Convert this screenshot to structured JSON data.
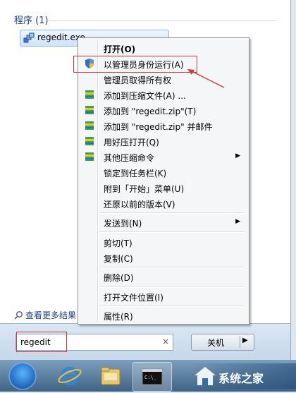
{
  "start_menu": {
    "section_header": "程序 (1)",
    "program": "regedit.exe",
    "see_more": "查看更多结果"
  },
  "context_menu": {
    "items": [
      {
        "label": "打开(O)",
        "icon": "none",
        "bold": true
      },
      {
        "label": "以管理员身份运行(A)",
        "icon": "uac-shield-icon"
      },
      {
        "label": "管理员取得所有权",
        "icon": "none"
      },
      {
        "label": "添加到压缩文件(A) ...",
        "icon": "archive-icon"
      },
      {
        "label": "添加到 \"regedit.zip\"(T)",
        "icon": "archive-icon"
      },
      {
        "label": "添加到 \"regedit.zip\" 并邮件",
        "icon": "archive-icon"
      },
      {
        "label": "用好压打开(Q)",
        "icon": "archive-icon"
      },
      {
        "label": "其他压缩命令",
        "icon": "archive-icon",
        "submenu": true
      },
      {
        "label": "锁定到任务栏(K)",
        "icon": "none"
      },
      {
        "label": "附到「开始」菜单(U)",
        "icon": "none"
      },
      {
        "label": "还原以前的版本(V)",
        "icon": "none"
      },
      {
        "label": "发送到(N)",
        "icon": "none",
        "submenu": true
      },
      {
        "label": "剪切(T)",
        "icon": "none"
      },
      {
        "label": "复制(C)",
        "icon": "none"
      },
      {
        "label": "删除(D)",
        "icon": "none"
      },
      {
        "label": "打开文件位置(I)",
        "icon": "none"
      },
      {
        "label": "属性(R)",
        "icon": "none"
      }
    ]
  },
  "search": {
    "value": "regedit",
    "clear": "×"
  },
  "shutdown": {
    "label": "关机",
    "arrow": "▶"
  },
  "watermark": {
    "text": "系统之家"
  },
  "colors": {
    "highlight_box": "#d23a3a",
    "header_text": "#1e3f8a"
  }
}
